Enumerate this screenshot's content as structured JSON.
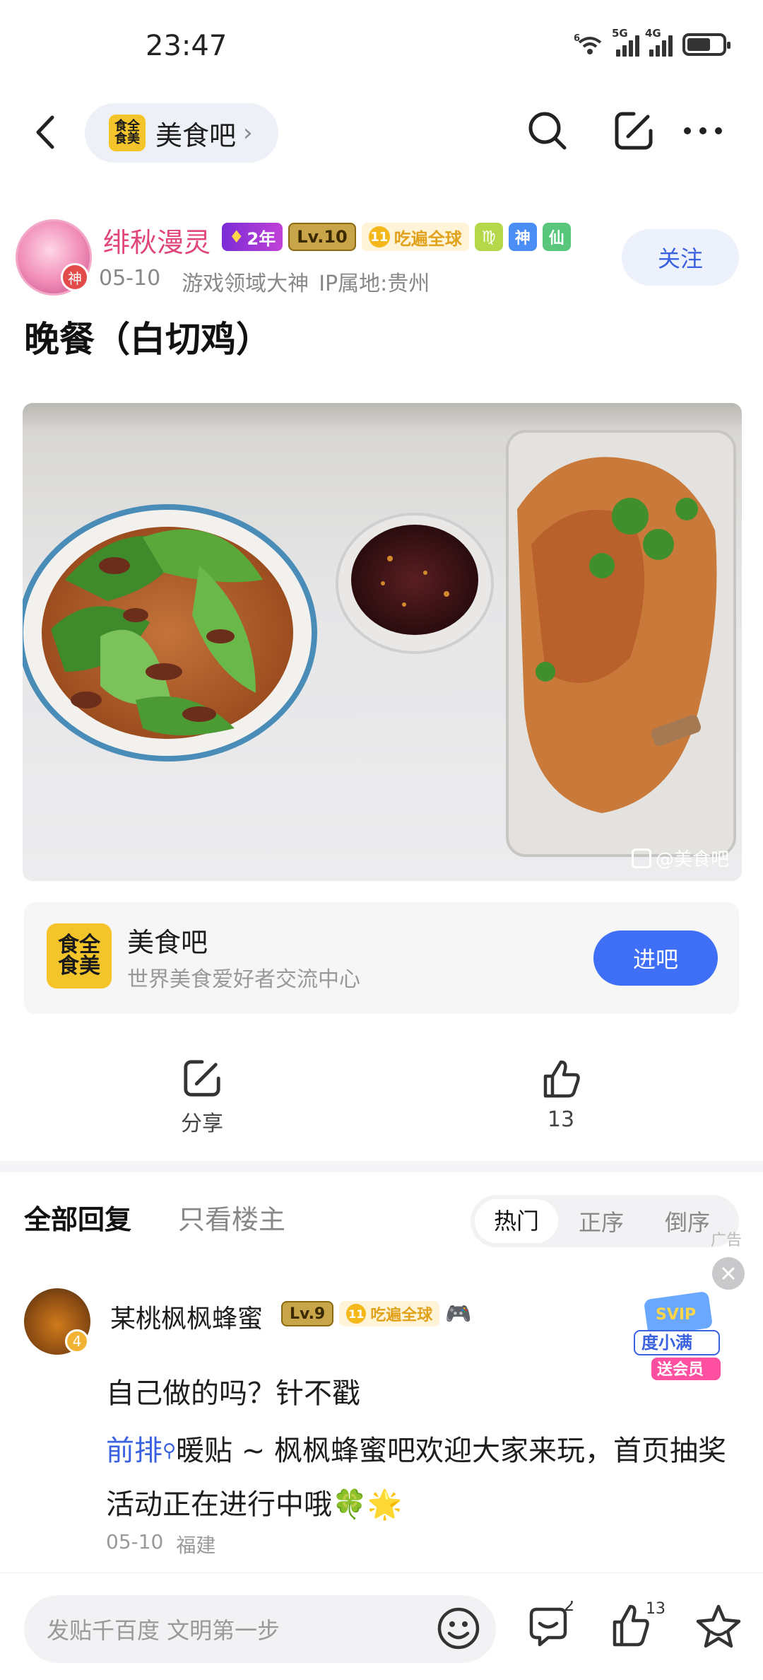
{
  "status": {
    "time": "23:47",
    "sig1_label": "5G",
    "sig2_label": "4G",
    "wifi_label": "6"
  },
  "nav": {
    "forum_name": "美食吧",
    "forum_logo_text": "食全食美"
  },
  "author": {
    "name": "绯秋漫灵",
    "avatar_badge": "神",
    "badges": {
      "years": "2年",
      "level": "Lv.10",
      "rank_num": "11",
      "title": "吃遍全球",
      "zodiac": "♍",
      "god": "神",
      "immortal": "仙"
    },
    "date": "05-10",
    "role": "游戏领域大神",
    "ip": "IP属地:贵州",
    "follow_label": "关注"
  },
  "post": {
    "title": "晚餐（白切鸡）",
    "watermark": "@美食吧"
  },
  "forum_card": {
    "name": "美食吧",
    "desc": "世界美食爱好者交流中心",
    "logo_text": "食全食美",
    "enter_label": "进吧"
  },
  "actions": {
    "share_label": "分享",
    "like_count": "13"
  },
  "replies": {
    "tab_all": "全部回复",
    "tab_op": "只看楼主",
    "sort": [
      "热门",
      "正序",
      "倒序"
    ],
    "ad_label": "广告",
    "comment": {
      "name": "某桃枫枫蜂蜜",
      "avatar_badge": "4",
      "level": "Lv.9",
      "rank_num": "11",
      "title": "吃遍全球",
      "text1": "自己做的吗？针不戳",
      "link": "前排",
      "text2": "暖贴 ~ 枫枫蜂蜜吧欢迎大家来玩，首页抽奖活动正在进行中哦🍀🌟",
      "date": "05-10",
      "location": "福建"
    },
    "ad": {
      "line1": "SVIP",
      "line2": "度小满",
      "line3": "送会员"
    }
  },
  "bottom": {
    "input_placeholder": "发贴千百度 文明第一步",
    "comment_count": "2",
    "like_count": "13"
  }
}
